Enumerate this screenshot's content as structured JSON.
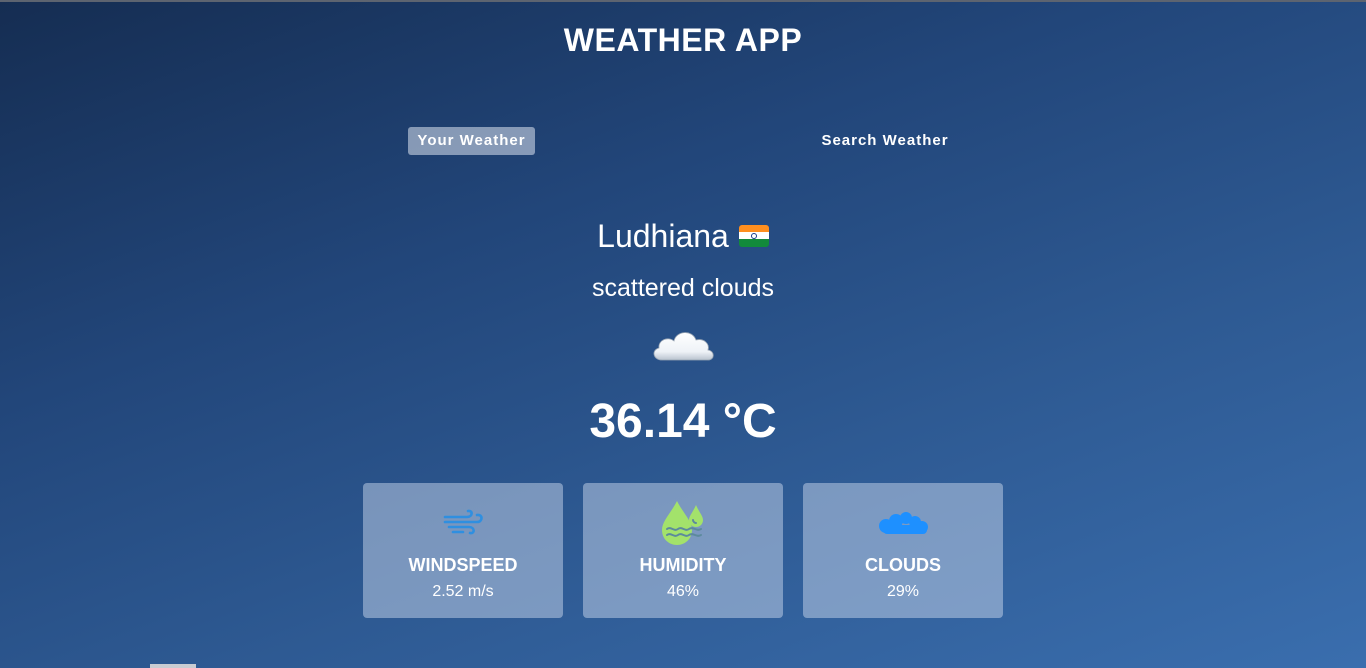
{
  "app": {
    "title": "WEATHER APP"
  },
  "tabs": [
    {
      "label": "Your Weather",
      "active": true
    },
    {
      "label": "Search Weather",
      "active": false
    }
  ],
  "weather": {
    "city": "Ludhiana",
    "country_flag": "india-flag-icon",
    "description": "scattered clouds",
    "condition_icon": "cloud-icon",
    "temperature": "36.14 °C"
  },
  "stats": [
    {
      "title": "WINDSPEED",
      "value": "2.52 m/s",
      "icon": "wind-icon",
      "icon_color": "#2f8fe0"
    },
    {
      "title": "HUMIDITY",
      "value": "46%",
      "icon": "humidity-icon",
      "icon_color": "#a3e26b"
    },
    {
      "title": "CLOUDS",
      "value": "29%",
      "icon": "clouds-icon",
      "icon_color": "#1e90ff"
    }
  ],
  "colors": {
    "background_start": "#152d52",
    "background_end": "#3a6eae",
    "active_tab": "#aebed6"
  }
}
